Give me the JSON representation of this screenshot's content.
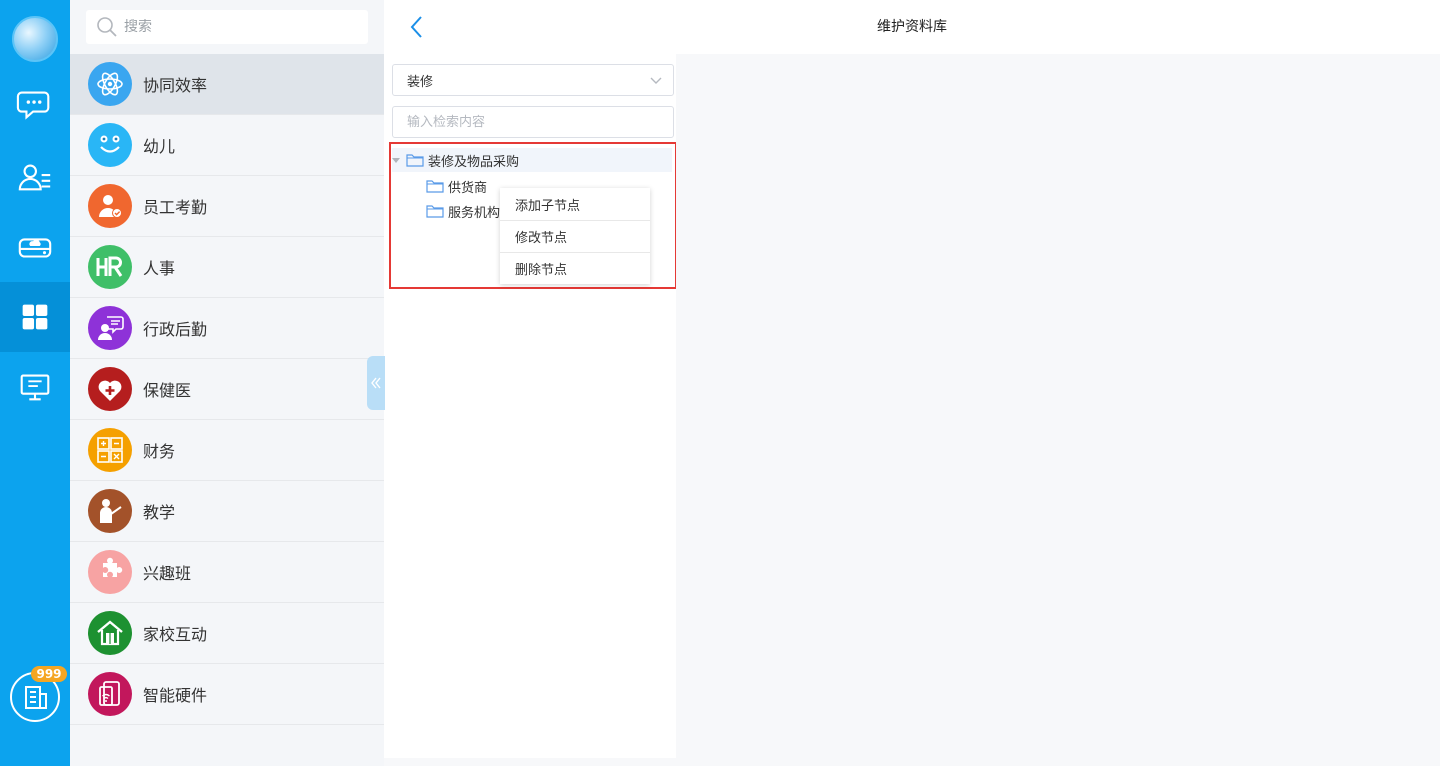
{
  "sidebar": {
    "badge": "999",
    "nav_icons": [
      "chat-icon",
      "contacts-icon",
      "cloud-drive-icon",
      "apps-grid-icon",
      "monitor-icon",
      "building-icon"
    ]
  },
  "applist": {
    "search_placeholder": "搜索",
    "items": [
      {
        "label": "协同效率",
        "icon": "atom-icon",
        "color": "#3aa6f0"
      },
      {
        "label": "幼儿",
        "icon": "smiley-icon",
        "color": "#29b6f6"
      },
      {
        "label": "员工考勤",
        "icon": "person-check-icon",
        "color": "#f0672f"
      },
      {
        "label": "人事",
        "icon": "hr-icon",
        "color": "#3fbf68"
      },
      {
        "label": "行政后勤",
        "icon": "admin-icon",
        "color": "#8e32d8"
      },
      {
        "label": "保健医",
        "icon": "heart-plus-icon",
        "color": "#b51e1e"
      },
      {
        "label": "财务",
        "icon": "calculator-icon",
        "color": "#f5a000"
      },
      {
        "label": "教学",
        "icon": "teacher-icon",
        "color": "#a3522a"
      },
      {
        "label": "兴趣班",
        "icon": "puzzle-icon",
        "color": "#f7a3a3"
      },
      {
        "label": "家校互动",
        "icon": "house-icon",
        "color": "#1d9131"
      },
      {
        "label": "智能硬件",
        "icon": "device-icon",
        "color": "#c2175c"
      }
    ]
  },
  "header": {
    "title": "维护资料库"
  },
  "tree_panel": {
    "category": "装修",
    "filter_placeholder": "输入检索内容",
    "root": "装修及物品采购",
    "children": [
      "供货商",
      "服务机构"
    ],
    "context_menu": [
      "添加子节点",
      "修改节点",
      "删除节点"
    ]
  },
  "colors": {
    "rail": "#0ca3ee",
    "accent": "#0ca3ee",
    "highlight_border": "#e53935",
    "badge": "#f5a623"
  }
}
